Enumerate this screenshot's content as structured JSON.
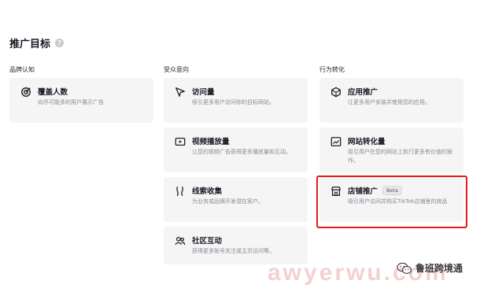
{
  "header": {
    "title": "推广目标"
  },
  "columns": [
    {
      "title": "品牌认知",
      "cards": [
        {
          "icon": "target-icon",
          "title": "覆盖人数",
          "desc": "向尽可能多的用户展示广告"
        }
      ]
    },
    {
      "title": "受众意向",
      "cards": [
        {
          "icon": "cursor-icon",
          "title": "访问量",
          "desc": "吸引更多用户访问你的目标网站。"
        },
        {
          "icon": "video-icon",
          "title": "视频播放量",
          "desc": "让您的视频广告获得更多播放量和互动。"
        },
        {
          "icon": "leads-icon",
          "title": "线索收集",
          "desc": "为业务或品牌开发潜在客户。"
        },
        {
          "icon": "community-icon",
          "title": "社区互动",
          "desc": "获得更多账号关注或主页访问等。"
        }
      ]
    },
    {
      "title": "行为转化",
      "cards": [
        {
          "icon": "app-icon",
          "title": "应用推广",
          "desc": "让更多用户安装并使用您的应用。"
        },
        {
          "icon": "chart-icon",
          "title": "网站转化量",
          "desc": "吸引用户在您的网站上执行更多有价值的操作。"
        },
        {
          "icon": "store-icon",
          "title": "店铺推广",
          "badge": "Beta",
          "desc": "吸引用户访问并购买TikTok店铺里的商品"
        }
      ]
    }
  ],
  "watermark": {
    "text": "awyerwu.com",
    "badge_text": "鲁班跨境通"
  },
  "colors": {
    "highlight": "#e21a1a",
    "card_bg": "#f5f5f6"
  }
}
